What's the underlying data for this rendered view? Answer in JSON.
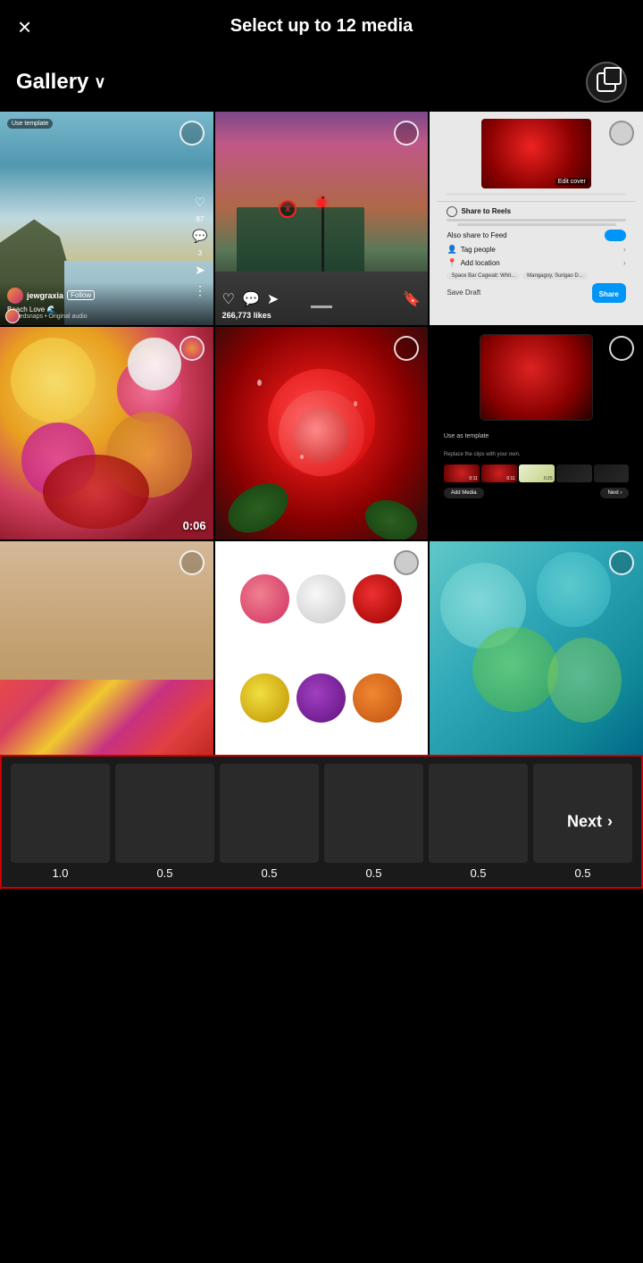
{
  "header": {
    "title": "Select up to 12 media",
    "close_label": "×"
  },
  "subheader": {
    "gallery_label": "Gallery",
    "chevron": "∨"
  },
  "grid": {
    "cells": [
      {
        "id": "beach",
        "type": "photo",
        "selected": false
      },
      {
        "id": "train",
        "type": "photo",
        "selected": false
      },
      {
        "id": "screenshot1",
        "type": "screenshot",
        "selected": false
      },
      {
        "id": "flowers",
        "type": "video",
        "duration": "0:06",
        "selected": false
      },
      {
        "id": "rose",
        "type": "photo",
        "selected": false
      },
      {
        "id": "app-screenshot",
        "type": "screenshot",
        "selected": false
      },
      {
        "id": "beige",
        "type": "photo",
        "selected": false
      },
      {
        "id": "stickers",
        "type": "photo",
        "selected": false
      },
      {
        "id": "teal-flowers",
        "type": "photo",
        "selected": false
      }
    ]
  },
  "tray": {
    "items": [
      {
        "duration": "1.0"
      },
      {
        "duration": "0.5"
      },
      {
        "duration": "0.5"
      },
      {
        "duration": "0.5"
      },
      {
        "duration": "0.5"
      },
      {
        "duration": "0.5"
      }
    ],
    "border_color": "#cc0000"
  },
  "next_button": {
    "label": "Next",
    "chevron": "›"
  },
  "post": {
    "likes": "266,773 likes"
  },
  "story": {
    "username": "jewgraxia",
    "follow": "Follow",
    "caption": "Beach Love 🌊",
    "audio": "alteredsnaps • Original audio",
    "template_badge": "Use template",
    "heart_count": "87",
    "comment_count": "3"
  }
}
